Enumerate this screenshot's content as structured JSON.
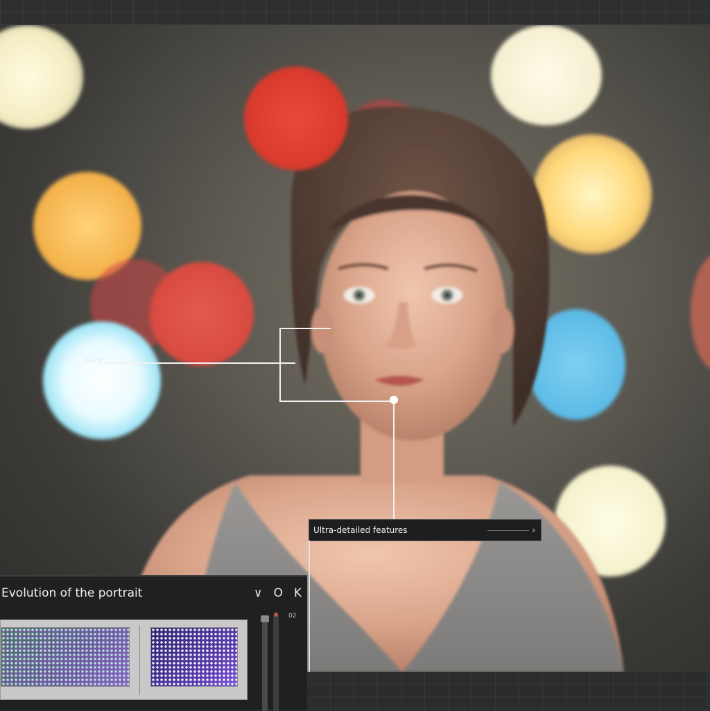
{
  "canvas": {
    "marker_label": "GAZE"
  },
  "feature_tag": {
    "label": "Ultra-detailed features",
    "chevron_icon": "chevron-right-icon"
  },
  "panel": {
    "title": "Evolution of the portrait",
    "controls": [
      {
        "name": "chevron-down-icon",
        "glyph": "∨"
      },
      {
        "name": "circle-icon",
        "glyph": "O"
      },
      {
        "name": "close-icon",
        "glyph": "K"
      }
    ],
    "side_number": "02"
  },
  "colors": {
    "bokeh_red": "#d8392c",
    "bokeh_amber": "#f4b24b",
    "bokeh_cyan": "#6fd6f0",
    "panel_bg": "#1f2022"
  }
}
